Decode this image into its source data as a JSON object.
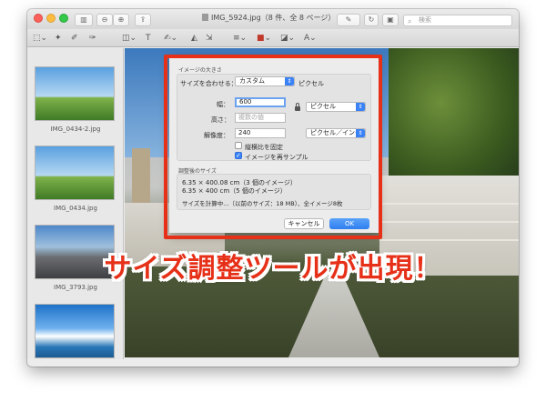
{
  "window": {
    "title": "IMG_5924.jpg（8 件、全 8 ページ）",
    "search_placeholder": "検索"
  },
  "sidebar": {
    "thumbnails": [
      {
        "label": "IMG_0434-2.jpg"
      },
      {
        "label": "IMG_0434.jpg"
      },
      {
        "label": "IMG_3793.jpg"
      },
      {
        "label": ""
      }
    ]
  },
  "dialog": {
    "section_title": "イメージの大きさ",
    "fit_label": "サイズを合わせる：",
    "fit_value": "カスタム",
    "fit_unit": "ピクセル",
    "width_label": "幅：",
    "width_value": "600",
    "height_label": "高さ：",
    "height_placeholder": "複数の値",
    "unit_value": "ピクセル",
    "resolution_label": "解像度：",
    "resolution_value": "240",
    "resolution_unit": "ピクセル／インチ",
    "keep_ratio_label": "縦横比を固定",
    "keep_ratio_checked": false,
    "resample_label": "イメージを再サンプル",
    "resample_checked": true,
    "result_title": "調整後のサイズ",
    "result_line1": "6.35 × 400.08 cm（3 個のイメージ）",
    "result_line2": "6.35 × 400 cm（5 個のイメージ）",
    "calc_line": "サイズを計算中...（以前のサイズ：18 MB）、全イメージ8枚",
    "cancel_label": "キャンセル",
    "ok_label": "OK"
  },
  "caption": "サイズ調整ツールが出現！",
  "colors": {
    "accent_red": "#e63018",
    "accent_blue": "#3b82f6"
  }
}
